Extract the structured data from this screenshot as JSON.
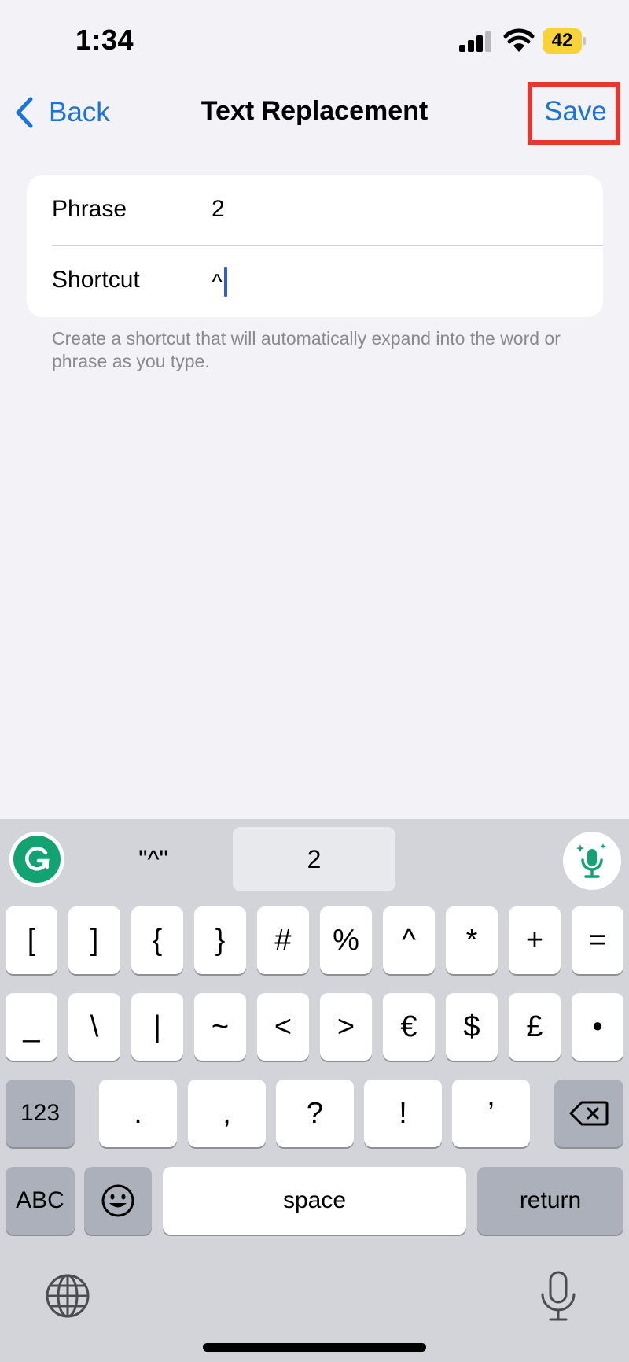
{
  "status_bar": {
    "time": "1:34",
    "battery_level": "42",
    "battery_color": "#f7d23a"
  },
  "nav": {
    "back_label": "Back",
    "title": "Text Replacement",
    "save_label": "Save",
    "accent_color": "#1b74d8",
    "highlight_color": "#e5372f"
  },
  "form": {
    "phrase_label": "Phrase",
    "phrase_value": "2",
    "shortcut_label": "Shortcut",
    "shortcut_value": "^",
    "footnote": "Create a shortcut that will automatically expand into the word or phrase as you type."
  },
  "keyboard": {
    "suggestions": [
      "\"^\"",
      "2"
    ],
    "row1": [
      "[",
      "]",
      "{",
      "}",
      "#",
      "%",
      "^",
      "*",
      "+",
      "="
    ],
    "row2": [
      "_",
      "\\",
      "|",
      "~",
      "<",
      ">",
      "€",
      "$",
      "£",
      "•"
    ],
    "row3": {
      "mode_key": "123",
      "keys": [
        ".",
        ",",
        "?",
        "!",
        "’"
      ]
    },
    "row4": {
      "abc_key": "ABC",
      "space": "space",
      "return": "return"
    },
    "icons": [
      "grammarly-icon",
      "mic-sparkle-icon",
      "backspace-icon",
      "emoji-icon",
      "globe-icon",
      "mic-icon"
    ]
  }
}
